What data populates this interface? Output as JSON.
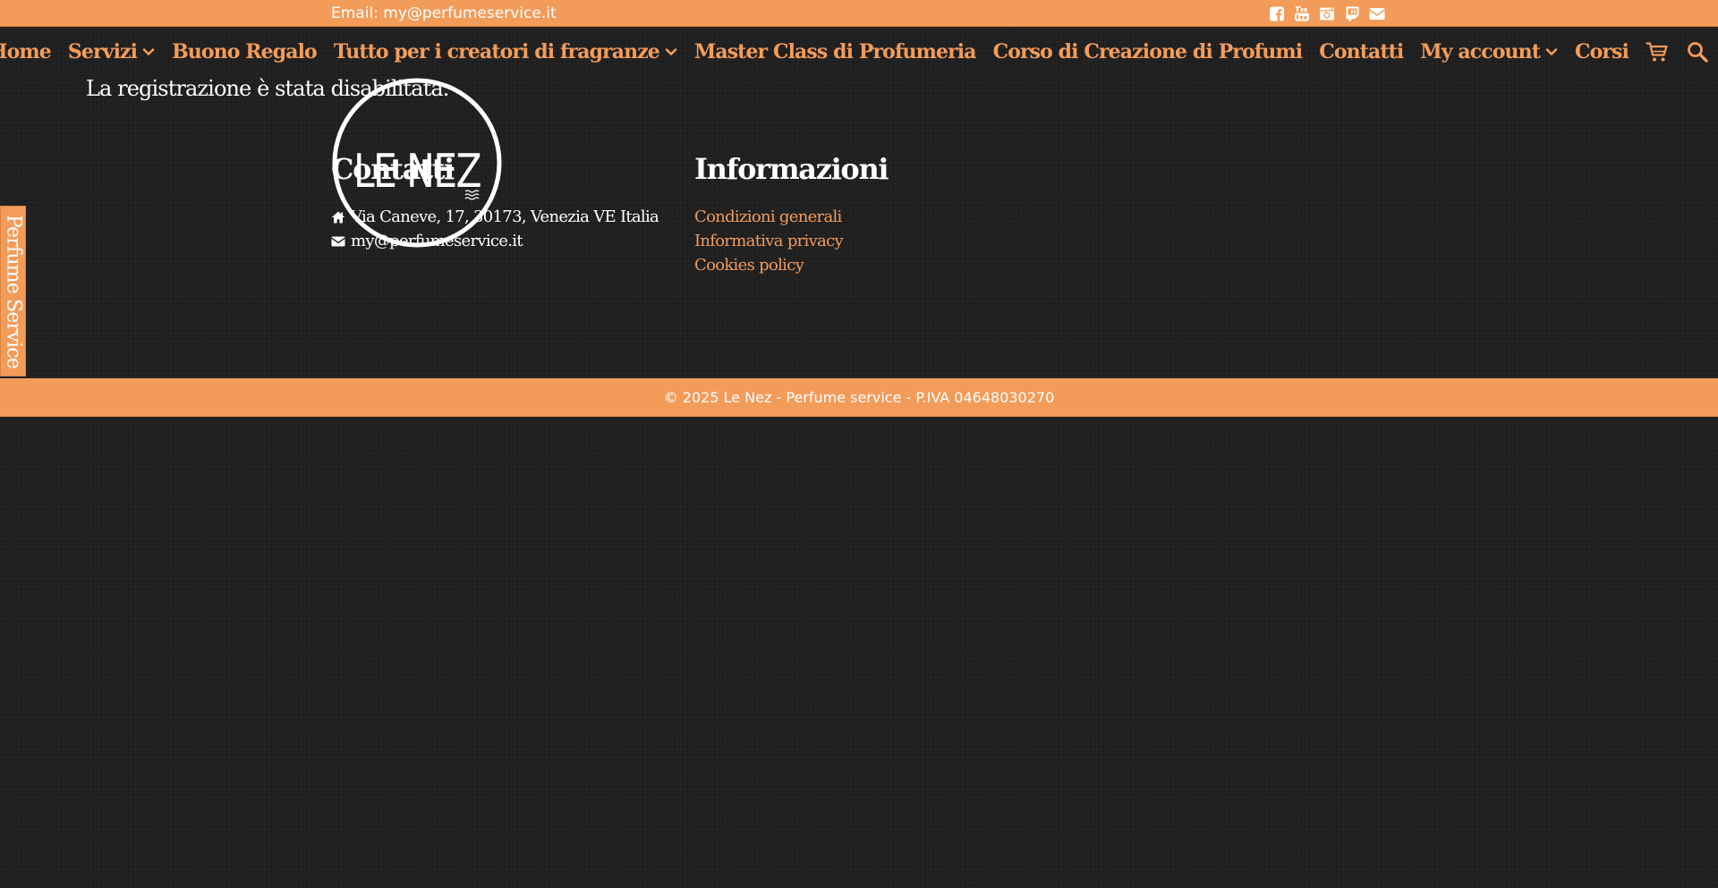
{
  "topbar": {
    "email": "Email: my@perfumeservice.it",
    "social_icons": [
      "facebook-icon",
      "youtube-icon",
      "instagram-icon",
      "twitch-icon",
      "envelope-icon"
    ]
  },
  "nav": {
    "items": [
      {
        "label": "Home",
        "dropdown": false
      },
      {
        "label": "Servizi",
        "dropdown": true
      },
      {
        "label": "Buono Regalo",
        "dropdown": false
      },
      {
        "label": "Tutto per i creatori di fragranze",
        "dropdown": true
      },
      {
        "label": "Master Class di Profumeria",
        "dropdown": false
      },
      {
        "label": "Corso di Creazione di Profumi",
        "dropdown": false
      },
      {
        "label": "Contatti",
        "dropdown": false
      },
      {
        "label": "My account",
        "dropdown": true
      },
      {
        "label": "Corsi",
        "dropdown": false
      }
    ],
    "icons": [
      "cart-icon",
      "search-icon"
    ]
  },
  "main": {
    "message": "La registrazione è stata disabilitata."
  },
  "logo": {
    "text": "LE NEZ"
  },
  "footer": {
    "contacts": {
      "title": "Contatti",
      "address": "Via Caneve, 17, 30173, Venezia VE Italia",
      "email": "my@perfumeservice.it"
    },
    "info": {
      "title": "Informazioni",
      "links": [
        "Condizioni generali",
        "Informativa privacy",
        "Cookies policy"
      ]
    },
    "copyright": "© 2025 Le Nez - Perfume service - P.IVA 04648030270"
  },
  "side_tab": {
    "label": "Perfume Service"
  },
  "colors": {
    "accent": "#f39c5a",
    "background": "#1f1f1f",
    "text": "#ffffff"
  }
}
